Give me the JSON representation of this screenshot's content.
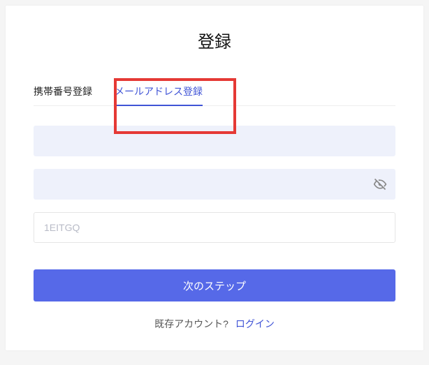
{
  "title": "登録",
  "tabs": {
    "phone": "携帯番号登録",
    "email": "メールアドレス登録"
  },
  "fields": {
    "email_value": "",
    "password_value": "",
    "code_placeholder": "1EITGQ"
  },
  "submit_label": "次のステップ",
  "footer": {
    "existing": "既存アカウント?",
    "login": "ログイン"
  },
  "colors": {
    "accent": "#5669e8",
    "highlight": "#e53935"
  }
}
